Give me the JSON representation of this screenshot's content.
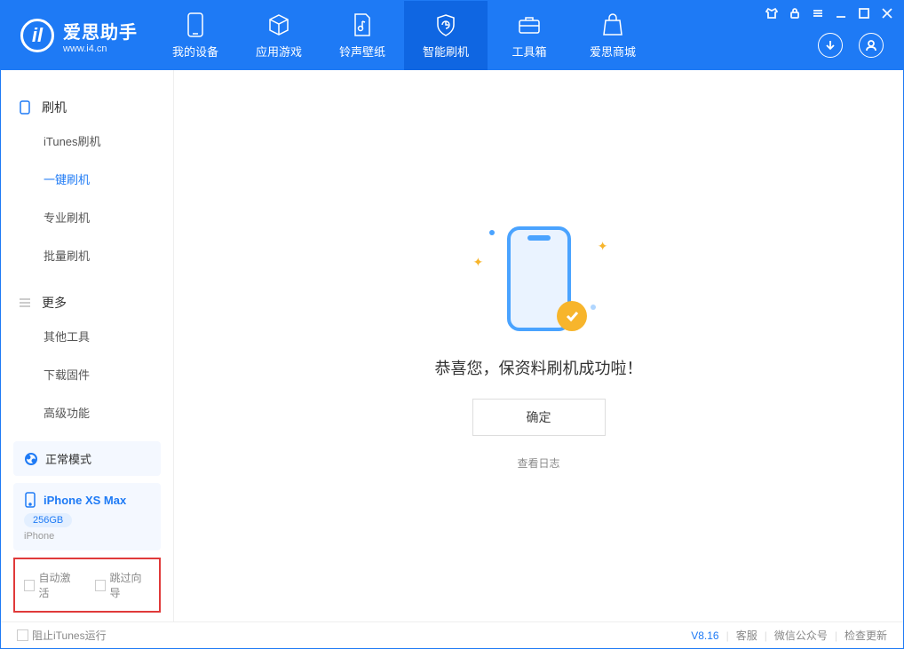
{
  "app": {
    "title": "爱思助手",
    "subtitle": "www.i4.cn"
  },
  "tabs": [
    {
      "label": "我的设备"
    },
    {
      "label": "应用游戏"
    },
    {
      "label": "铃声壁纸"
    },
    {
      "label": "智能刷机"
    },
    {
      "label": "工具箱"
    },
    {
      "label": "爱思商城"
    }
  ],
  "sidebar": {
    "groups": [
      {
        "title": "刷机",
        "items": [
          {
            "label": "iTunes刷机"
          },
          {
            "label": "一键刷机",
            "active": true
          },
          {
            "label": "专业刷机"
          },
          {
            "label": "批量刷机"
          }
        ]
      },
      {
        "title": "更多",
        "items": [
          {
            "label": "其他工具"
          },
          {
            "label": "下载固件"
          },
          {
            "label": "高级功能"
          }
        ]
      }
    ],
    "mode": "正常模式",
    "device": {
      "name": "iPhone XS Max",
      "storage": "256GB",
      "type": "iPhone"
    },
    "checkboxes": {
      "auto_activate": "自动激活",
      "skip_guide": "跳过向导"
    }
  },
  "main": {
    "success_text": "恭喜您，保资料刷机成功啦！",
    "confirm": "确定",
    "view_log": "查看日志"
  },
  "footer": {
    "block_itunes": "阻止iTunes运行",
    "version": "V8.16",
    "cs": "客服",
    "wechat": "微信公众号",
    "update": "检查更新"
  }
}
